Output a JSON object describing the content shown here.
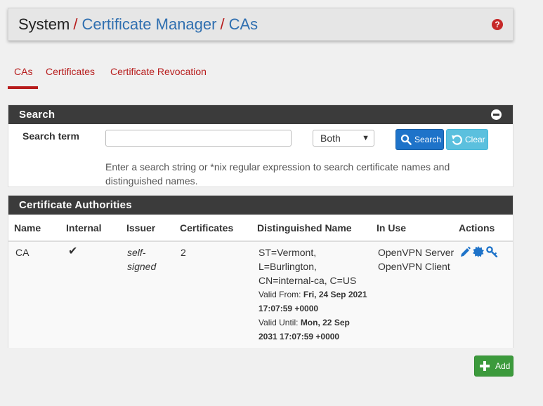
{
  "breadcrumb": {
    "root": "System",
    "sep": "/",
    "level1": "Certificate Manager",
    "level2": "CAs"
  },
  "help_icon": "question-circle-icon",
  "tabs": [
    {
      "label": "CAs",
      "active": true
    },
    {
      "label": "Certificates",
      "active": false
    },
    {
      "label": "Certificate Revocation",
      "active": false
    }
  ],
  "search": {
    "title": "Search",
    "term_label": "Search term",
    "input_value": "",
    "scope_selected": "Both",
    "search_button": "Search",
    "clear_button": "Clear",
    "help_text": "Enter a search string or *nix regular expression to search certificate names and distinguished names."
  },
  "ca_table": {
    "title": "Certificate Authorities",
    "headers": [
      "Name",
      "Internal",
      "Issuer",
      "Certificates",
      "Distinguished Name",
      "In Use",
      "Actions"
    ],
    "rows": [
      {
        "name": "CA",
        "internal": "✔",
        "issuer_line1": "self-",
        "issuer_line2": "signed",
        "certificates": "2",
        "dn_line1": "ST=Vermont,",
        "dn_line2": "L=Burlington,",
        "dn_line3": "CN=internal-ca, C=US",
        "valid_from_label": "Valid From:",
        "valid_from_value_1": "Fri, 24 Sep 2021",
        "valid_from_value_2": "17:07:59 +0000",
        "valid_until_label": "Valid Until:",
        "valid_until_value_1": "Mon, 22 Sep",
        "valid_until_value_2": "2031 17:07:59 +0000",
        "in_use_1": "OpenVPN Server",
        "in_use_2": "OpenVPN Client",
        "actions": [
          "edit-pencil-icon",
          "certificate-badge-icon",
          "key-icon"
        ]
      }
    ]
  },
  "add_button": "Add",
  "colors": {
    "accent_red": "#b71c1c",
    "link_blue": "#2f6fb0",
    "panel_header": "#3b3b3b",
    "search_btn": "#1e73c9",
    "clear_btn": "#5bc0de",
    "add_btn": "#3c9a3c"
  }
}
